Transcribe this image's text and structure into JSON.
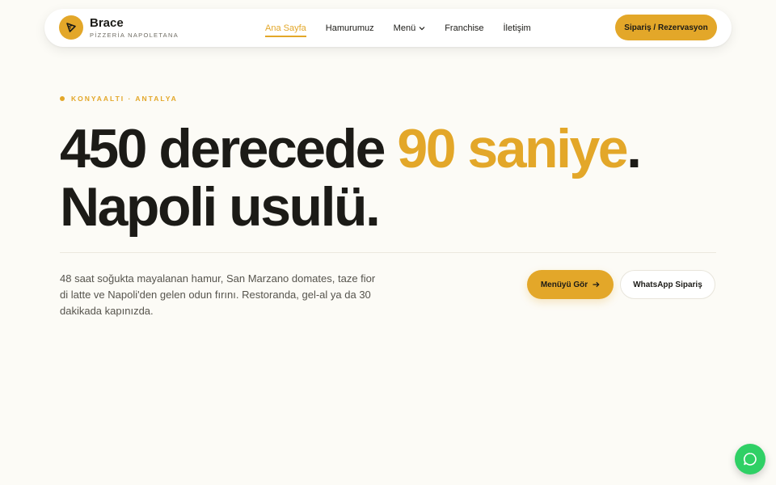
{
  "brand": {
    "name": "Brace",
    "subtitle": "PİZZERİA NAPOLETANA",
    "logo_icon": "pizza-slice-icon"
  },
  "nav": {
    "items": [
      {
        "label": "Ana Sayfa",
        "active": true
      },
      {
        "label": "Hamurumuz",
        "active": false
      },
      {
        "label": "Menü",
        "active": false,
        "has_dropdown": true
      },
      {
        "label": "Franchise",
        "active": false
      },
      {
        "label": "İletişim",
        "active": false
      }
    ],
    "cta_label": "Sipariş / Rezervasyon"
  },
  "hero": {
    "eyebrow": "KONYAALTI · ANTALYA",
    "headline_part1": "450 derecede ",
    "headline_accent": "90 saniye",
    "headline_part2": ". Napoli usulü.",
    "description": "48 saat soğukta mayalanan hamur, San Marzano domates, taze fior di latte ve Napoli'den gelen odun fırını. Restoranda, gel-al ya da 30 dakikada kapınızda.",
    "primary_button": "Menüyü Gör",
    "secondary_button": "WhatsApp Sipariş"
  },
  "colors": {
    "accent": "#e3a729",
    "text": "#1c1b17",
    "background": "#fcfbf6",
    "whatsapp": "#2fd065"
  },
  "chat": {
    "icon": "chat-bubble-icon"
  }
}
